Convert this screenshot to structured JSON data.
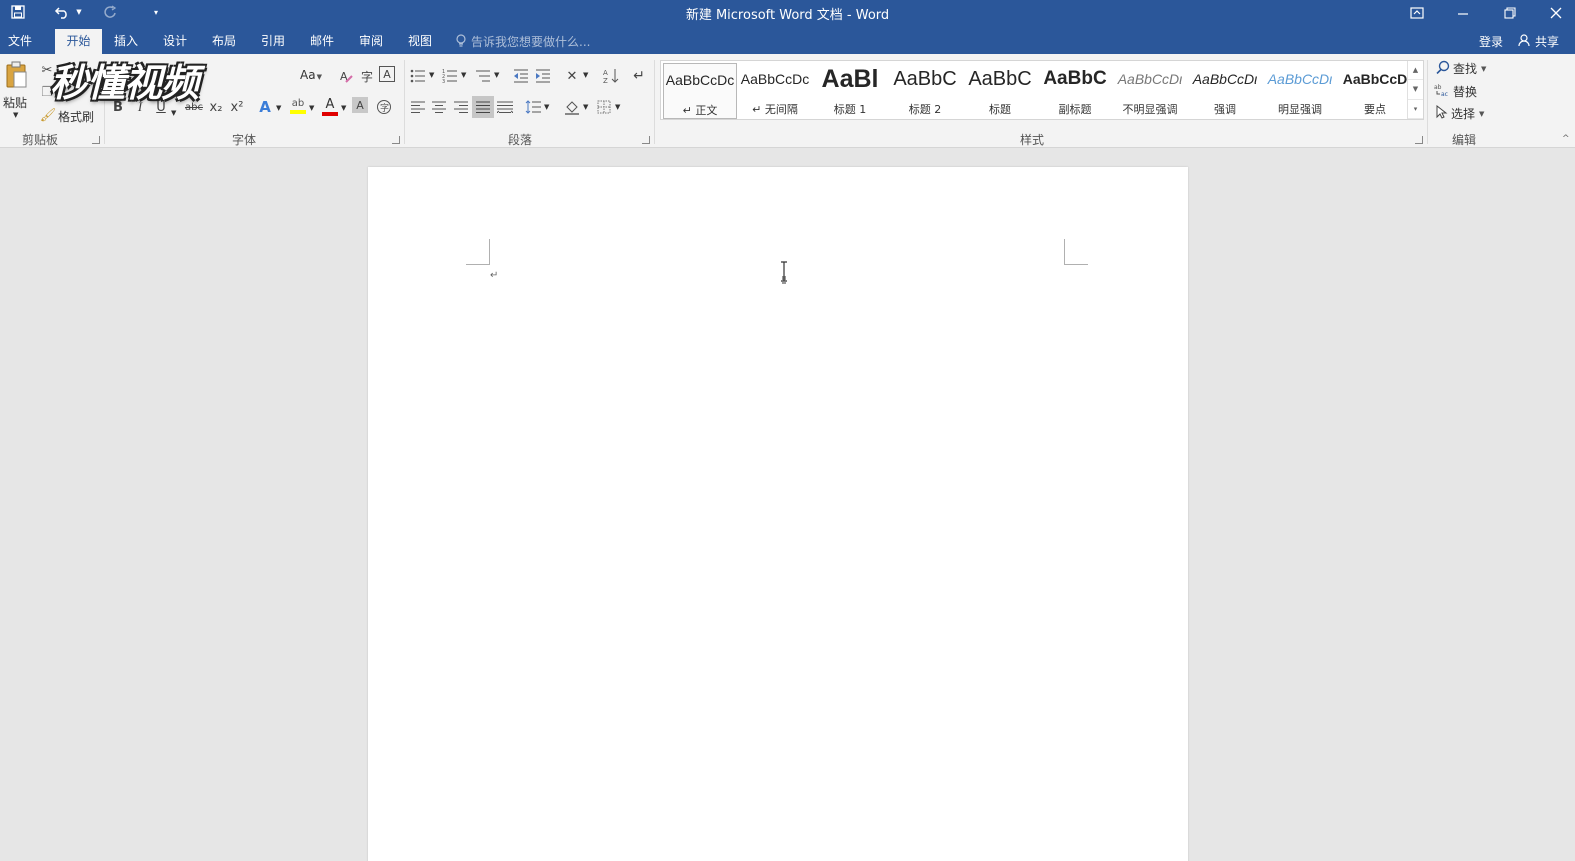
{
  "window": {
    "title": "新建 Microsoft Word 文档 - Word",
    "accent": "#2b579a"
  },
  "qat": {
    "save_icon": "save-icon",
    "undo_icon": "undo-icon",
    "redo_icon": "redo-icon",
    "customize_icon": "chevron-down-icon"
  },
  "tabs": [
    {
      "label": "文件"
    },
    {
      "label": "开始"
    },
    {
      "label": "插入"
    },
    {
      "label": "设计"
    },
    {
      "label": "布局"
    },
    {
      "label": "引用"
    },
    {
      "label": "邮件"
    },
    {
      "label": "审阅"
    },
    {
      "label": "视图"
    }
  ],
  "active_tab": "开始",
  "tellme": {
    "placeholder": "告诉我您想要做什么..."
  },
  "account": {
    "signin": "登录",
    "share": "共享"
  },
  "clipboard": {
    "paste_label": "粘贴",
    "format_painter_label": "格式刷",
    "group_label": "剪贴板"
  },
  "font": {
    "group_label": "字体",
    "change_case_label": "Aa",
    "bold": "B",
    "italic": "I",
    "underline": "U",
    "strikethrough": "abc",
    "subscript": "x₂",
    "superscript": "x²",
    "font_color_letter": "A",
    "highlight_letter": "ab"
  },
  "paragraph": {
    "group_label": "段落"
  },
  "styles": {
    "group_label": "样式",
    "items": [
      {
        "sample": "AaBbCcDc",
        "name": "↵ 正文"
      },
      {
        "sample": "AaBbCcDc",
        "name": "↵ 无间隔"
      },
      {
        "sample": "AaBl",
        "name": "标题 1"
      },
      {
        "sample": "AaBbC",
        "name": "标题 2"
      },
      {
        "sample": "AaBbC",
        "name": "标题"
      },
      {
        "sample": "AaBbC",
        "name": "副标题"
      },
      {
        "sample": "AaBbCcDι",
        "name": "不明显强调"
      },
      {
        "sample": "AaBbCcDι",
        "name": "强调"
      },
      {
        "sample": "AaBbCcDι",
        "name": "明显强调"
      },
      {
        "sample": "AaBbCcD",
        "name": "要点"
      }
    ]
  },
  "editing": {
    "group_label": "编辑",
    "find": "查找",
    "replace": "替换",
    "select": "选择"
  },
  "watermark": {
    "text": "秒懂视频"
  },
  "document": {
    "paragraph_mark": "↵"
  }
}
